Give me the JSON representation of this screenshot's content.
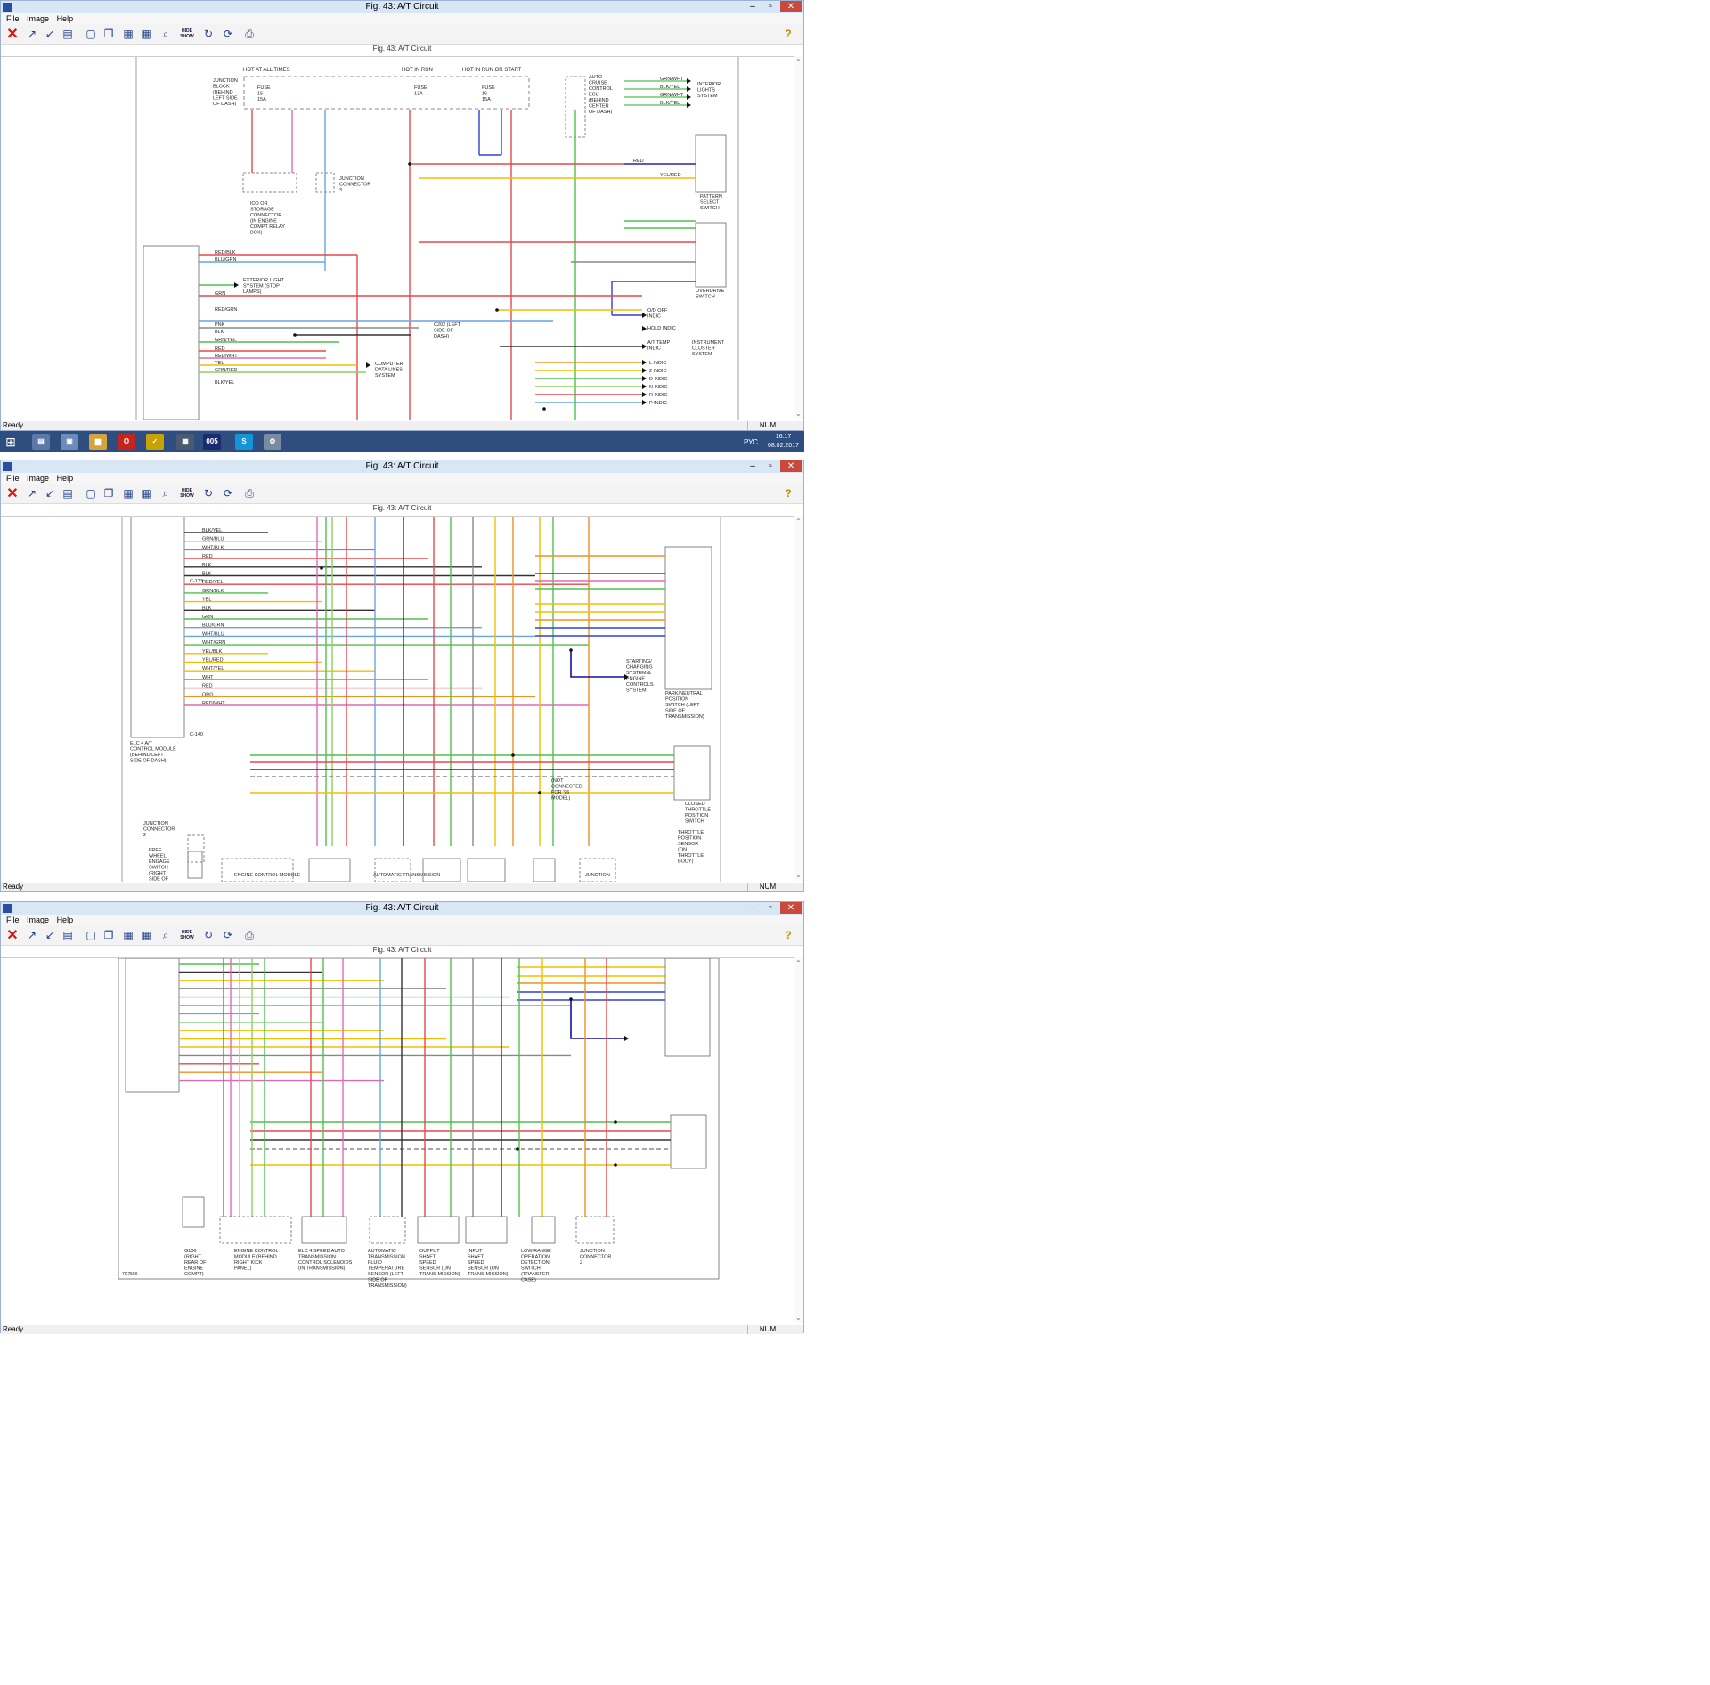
{
  "window": {
    "title": "Fig. 43: A/T Circuit",
    "caption": "Fig. 43: A/T Circuit",
    "minimize_icon": "minimize-icon",
    "maximize_icon": "maximize-icon",
    "close_label": "✕"
  },
  "menu": {
    "file": "File",
    "image": "Image",
    "help": "Help"
  },
  "toolbar": {
    "hide_show": "HIDE SHOW",
    "icons": [
      "close-x-icon",
      "zoom-in-icon",
      "zoom-out-icon",
      "fit-page-icon",
      "page-icon",
      "copy-icon",
      "print-preview-icon",
      "print-icon",
      "find-icon",
      "hide-show-icon",
      "rotate-icon",
      "refresh-icon",
      "printer-icon",
      "help-icon"
    ]
  },
  "status": {
    "ready": "Ready",
    "num": "NUM"
  },
  "taskbar": {
    "lang": "РУС",
    "time": "16:17",
    "date": "08.02.2017",
    "app_label": "005"
  },
  "diagram": {
    "top": {
      "hot_at_all_times": "HOT AT ALL TIMES",
      "hot_in_run": "HOT IN RUN",
      "hot_in_run_or_start": "HOT IN RUN OR START",
      "junction_block": "JUNCTION BLOCK (BEHIND LEFT SIDE OF DASH)",
      "fuse1": "FUSE 15 15A",
      "fuse2": "FUSE 13A",
      "fuse3": "FUSE 16 15A",
      "auto_cruise": "AUTO CRUISE CONTROL ECU (BEHIND CENTER OF DASH)",
      "interior_lights": "INTERIOR LIGHTS SYSTEM",
      "iod_connector": "IOD OR STORAGE CONNECTOR (IN ENGINE COMPT RELAY BOX)",
      "junction_connector_3": "JUNCTION CONNECTOR 3",
      "exterior_light": "EXTERIOR LIGHT SYSTEM (STOP LAMPS)",
      "pattern_select": "PATTERN SELECT SWITCH",
      "overdrive_switch": "OVERDRIVE SWITCH",
      "od_off": "O/D OFF INDIC",
      "hold_indic": "HOLD INDIC",
      "at_temp": "A/T TEMP INDIC",
      "instrument_cluster": "INSTRUMENT CLUSTER SYSTEM",
      "c202": "C202 (LEFT SIDE OF DASH)",
      "computer_data": "COMPUTER DATA LINES SYSTEM",
      "indic": [
        "L INDIC",
        "2 INDIC",
        "D INDIC",
        "N INDIC",
        "R INDIC",
        "P INDIC"
      ],
      "pins": [
        "RED/BLK",
        "BLU/GRN",
        "GRN",
        "RED/GRN",
        "PNK",
        "BLK",
        "GRN/YEL",
        "RED",
        "RED/WHT",
        "YEL",
        "GRN/RED",
        "BLK/YEL"
      ]
    },
    "middle": {
      "pins": [
        "BLK/YEL",
        "GRN/BLU",
        "WHT/BLK",
        "RED",
        "BLK",
        "BLK",
        "RED/YEL",
        "GRN/BLK",
        "YEL",
        "BLK",
        "GRN",
        "BLU/GRN",
        "WHT/BLU",
        "WHT/GRN",
        "YEL/BLK",
        "YEL/RED",
        "WHT/YEL",
        "WHT",
        "RED",
        "ORG",
        "RED/WHT"
      ],
      "c133": "C-133",
      "c140": "C-140",
      "ecu": "ELC 4 A/T CONTROL MODULE (BEHIND LEFT SIDE OF DASH)",
      "junction_connector_2": "JUNCTION CONNECTOR 2",
      "free_wheel": "FREE WHEEL ENGAGE SWITCH (RIGHT SIDE OF ENGINE COMPT)",
      "engine_control": "ENGINE CONTROL MODULE",
      "automatic_trans": "AUTOMATIC TRANSMISSION",
      "starting": "STARTING/ CHARGING SYSTEM & ENGINE CONTROLS SYSTEM",
      "park_neutral": "PARK/NEUTRAL POSITION SWITCH (LEFT SIDE OF TRANSMISSION)",
      "closed_throttle": "CLOSED THROTTLE POSITION SWITCH",
      "tps": "THROTTLE POSITION SENSOR (ON THROTTLE BODY)",
      "not_connected": "(NOT CONNECTED FOR '96 MODEL)",
      "junction": "JUNCTION"
    },
    "bottom": {
      "engine_control": "ENGINE CONTROL MODULE (BEHIND RIGHT KICK PANEL)",
      "elc": "ELC 4 SPEED AUTO TRANSMISSION CONTROL SOLENOIDS (IN TRANSMISSION)",
      "fluid_temp": "AUTOMATIC TRANSMISSION FLUID TEMPERATURE SENSOR (LEFT SIDE OF TRANSMISSION)",
      "output_shaft": "OUTPUT SHAFT SPEED SENSOR (ON TRANS-MISSION)",
      "input_shaft": "INPUT SHAFT SPEED SENSOR (ON TRANS-MISSION)",
      "low_range": "LOW-RANGE OPERATION DETECTION SWITCH (TRANSFER CASE)",
      "junction_connector_2": "JUNCTION CONNECTOR 2",
      "g106": "G106 (RIGHT REAR OF ENGINE COMPT)",
      "code": "7C7556"
    }
  },
  "wire_colors": {
    "red": "#e8474a",
    "pink": "#e06ab0",
    "green": "#4fc04b",
    "lightgreen": "#8fd15a",
    "yellow": "#f0c000",
    "orange": "#f09020",
    "blue": "#3040d0",
    "lightblue": "#6aa4e0",
    "gray": "#888888",
    "darkgray": "#333333",
    "magenta": "#c010a0",
    "navy": "#1010a0"
  }
}
